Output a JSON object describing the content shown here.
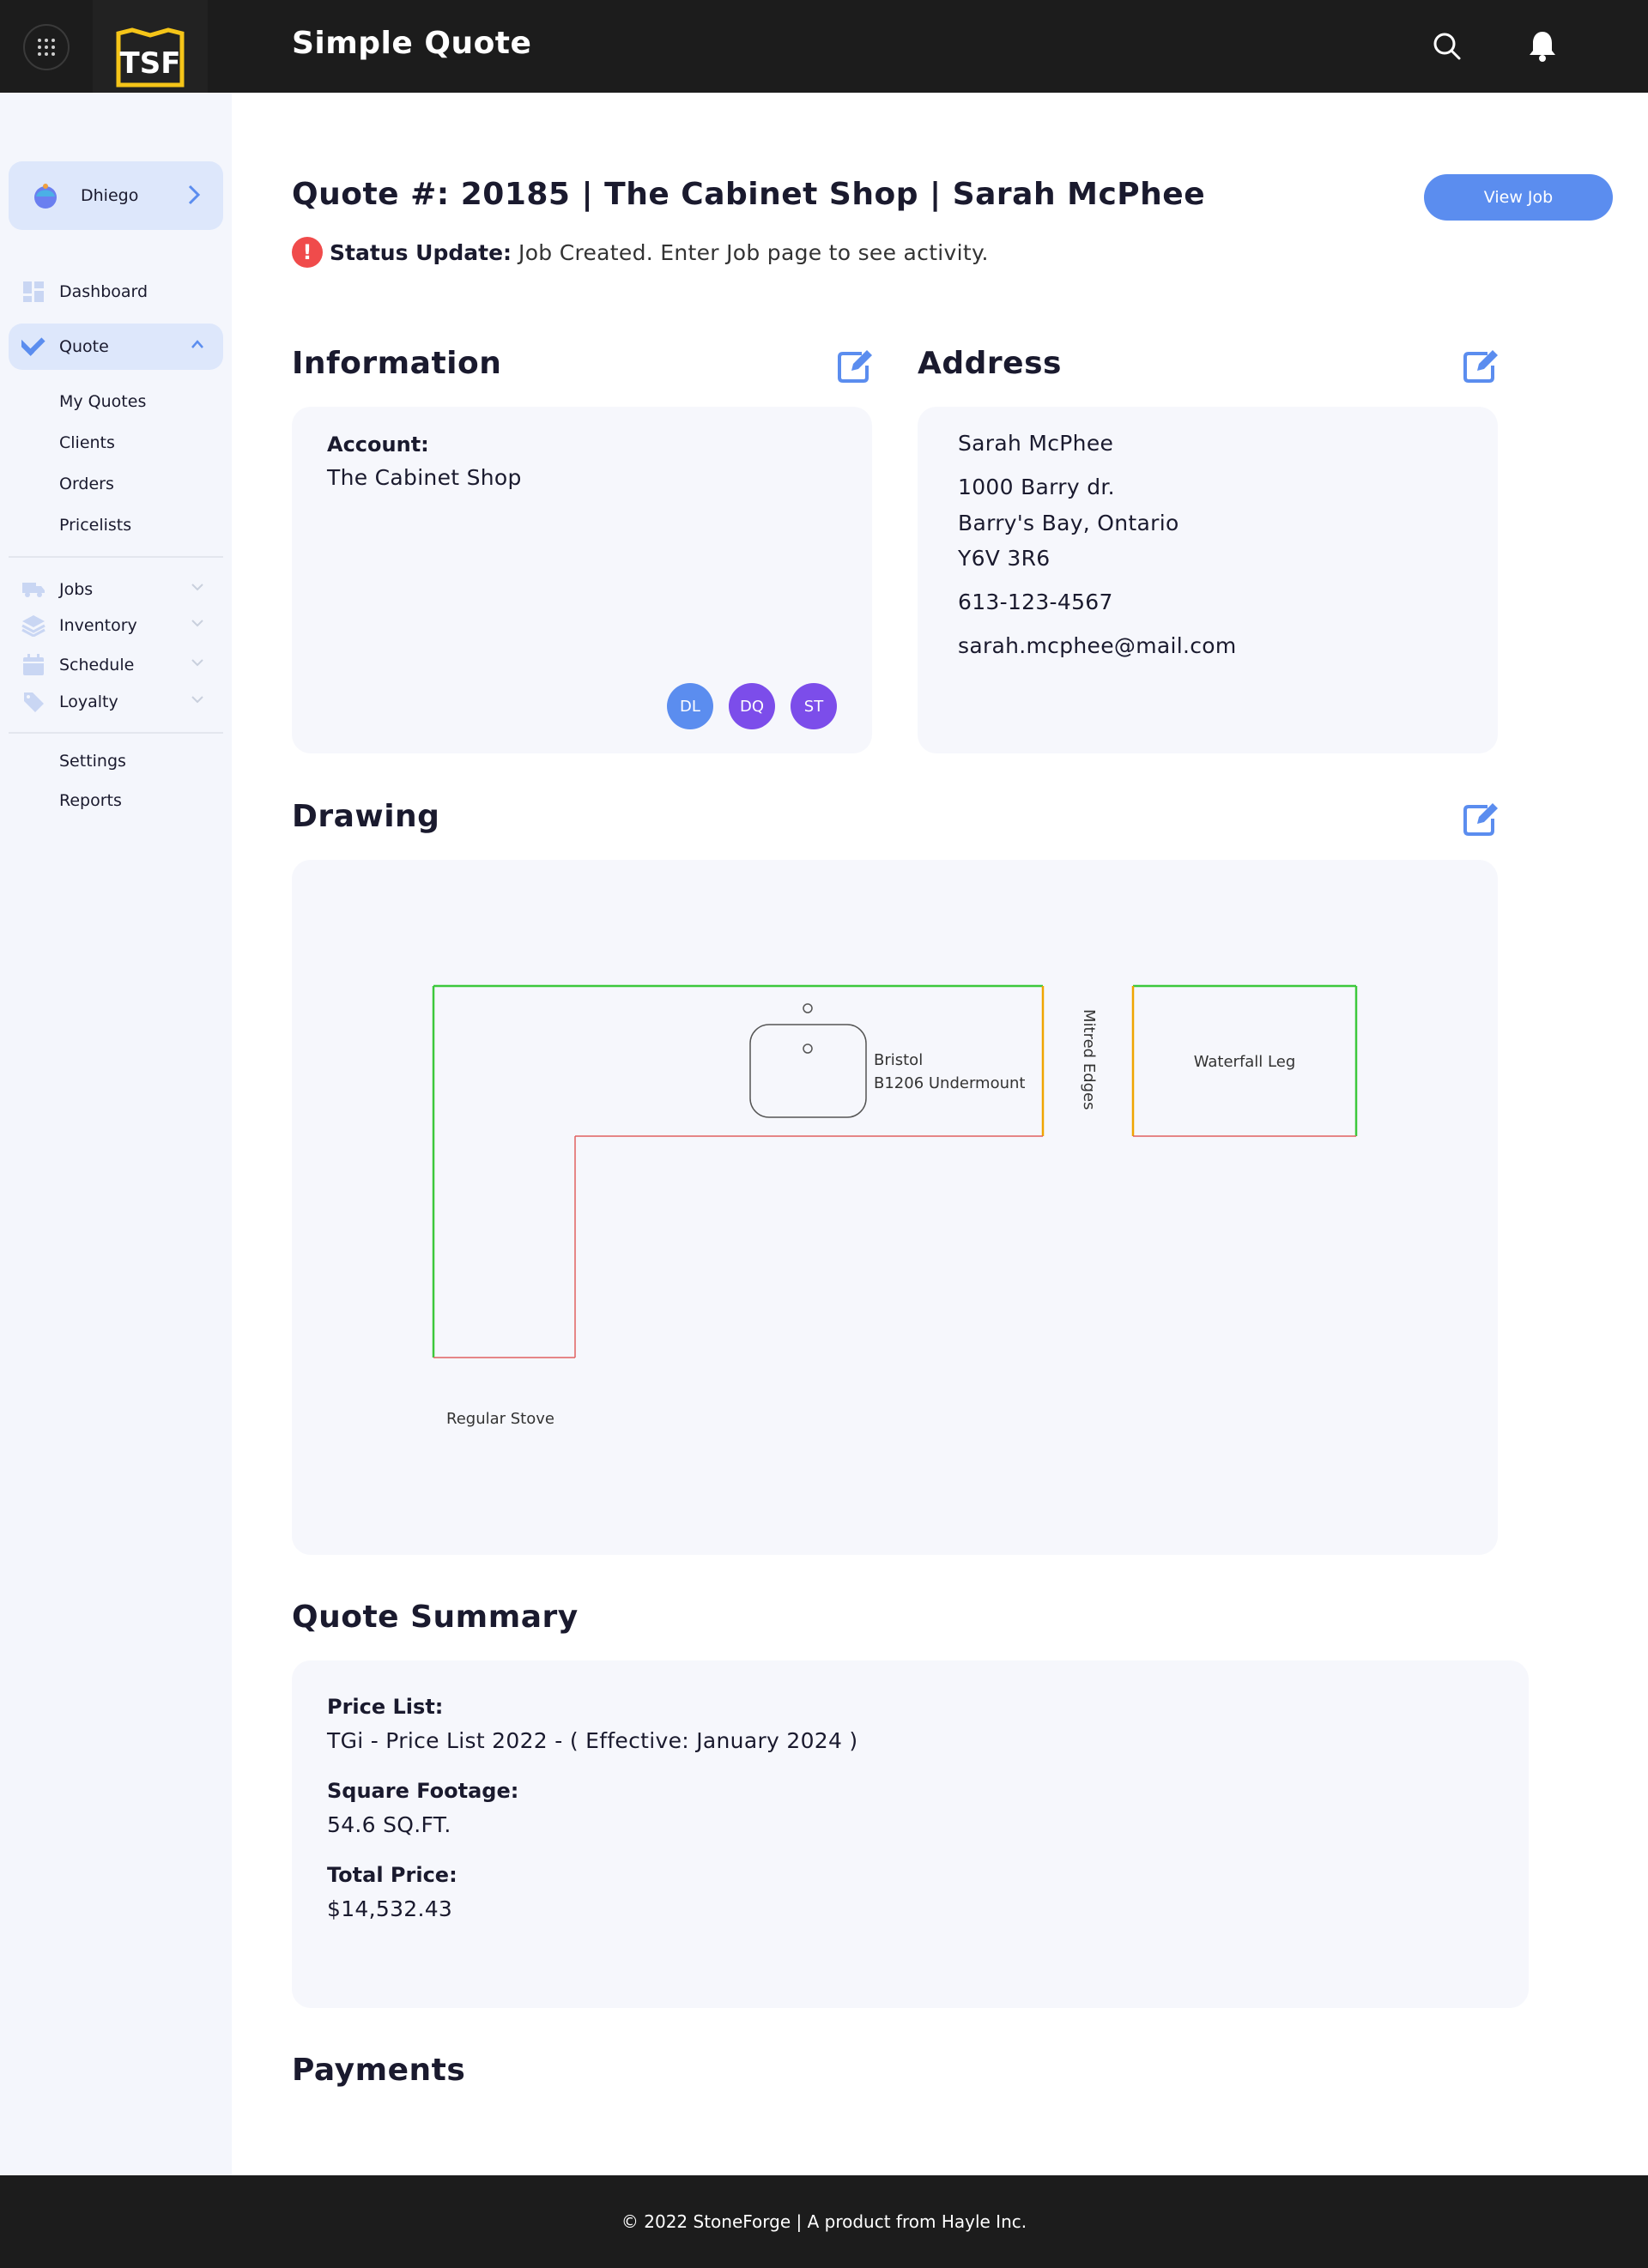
{
  "header": {
    "logo_text": "TSF",
    "app_title": "Simple Quote",
    "icons": [
      "apps-grid-icon",
      "search-icon",
      "bell-icon"
    ]
  },
  "sidebar": {
    "user": {
      "name": "Dhiego"
    },
    "nav": {
      "dashboard": "Dashboard",
      "quote": "Quote",
      "quote_sub": [
        "My Quotes",
        "Clients",
        "Orders",
        "Pricelists"
      ],
      "jobs": "Jobs",
      "inventory": "Inventory",
      "schedule": "Schedule",
      "loyalty": "Loyalty",
      "settings": "Settings",
      "reports": "Reports"
    }
  },
  "main": {
    "quote_title": "Quote #: 20185 | The Cabinet Shop | Sarah McPhee",
    "view_job_label": "View Job",
    "status": {
      "label": "Status Update:",
      "text": "Job Created. Enter Job page to see activity."
    },
    "information": {
      "title": "Information",
      "account_label": "Account:",
      "account_value": "The Cabinet Shop",
      "assignees": [
        {
          "initials": "DL",
          "color": "#5b8def"
        },
        {
          "initials": "DQ",
          "color": "#7c4dea"
        },
        {
          "initials": "ST",
          "color": "#7c4dea"
        }
      ]
    },
    "address": {
      "title": "Address",
      "name": "Sarah McPhee",
      "street": "1000 Barry dr.",
      "city": "Barry's Bay, Ontario",
      "postal": "Y6V 3R6",
      "phone": "613-123-4567",
      "email": "sarah.mcphee@mail.com"
    },
    "drawing": {
      "title": "Drawing",
      "labels": {
        "sink_line1": "Bristol",
        "sink_line2": "B1206 Undermount",
        "mitred": "Mitred Edges",
        "waterfall": "Waterfall Leg",
        "stove": "Regular Stove"
      },
      "edge_colors": {
        "finished": "#3cc83c",
        "mitred": "#f0a500",
        "wall": "#e06060",
        "outline": "#555555"
      }
    },
    "summary": {
      "title": "Quote Summary",
      "price_list_label": "Price List:",
      "price_list_value": "TGi - Price List 2022 - ( Effective: January 2024 )",
      "sqft_label": "Square Footage:",
      "sqft_value": "54.6 SQ.FT.",
      "total_label": "Total Price:",
      "total_value": "$14,532.43"
    },
    "payments": {
      "title": "Payments"
    }
  },
  "footer": {
    "text": "© 2022 StoneForge | A product from Hayle Inc."
  },
  "colors": {
    "accent": "#5b8def",
    "dark": "#1c1c1c",
    "panel": "#f6f7fc",
    "logo_yellow": "#f5c518"
  }
}
